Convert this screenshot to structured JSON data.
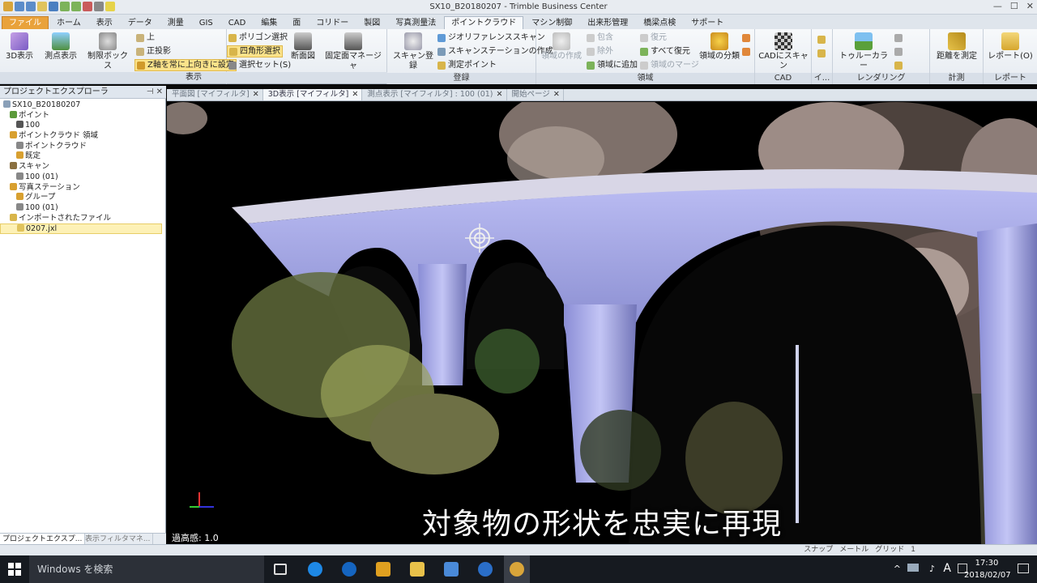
{
  "window": {
    "title": "SX10_B20180207 - Trimble Business Center"
  },
  "tabs": [
    "ファイル",
    "ホーム",
    "表示",
    "データ",
    "測量",
    "GIS",
    "CAD",
    "編集",
    "面",
    "コリドー",
    "製図",
    "写真測量法",
    "ポイントクラウド",
    "マシン制御",
    "出来形管理",
    "橋梁点検",
    "サポート"
  ],
  "ribbon": {
    "view": {
      "label": "表示",
      "buttons": [
        "3D表示",
        "測点表示",
        "制限ボックス",
        "断面図",
        "固定面マネージャ"
      ],
      "small": [
        "上",
        "正投影",
        "Z軸を常に上向きに設定",
        "ポリゴン選択",
        "四角形選択",
        "選択セット(S)"
      ]
    },
    "register": {
      "label": "登録",
      "buttons": [
        "スキャン登録"
      ],
      "small": [
        "ジオリファレンススキャン",
        "スキャンステーションの作成",
        "測定ポイント"
      ]
    },
    "region": {
      "label": "領域",
      "buttons": [
        "領域の作成",
        "領域の分類"
      ],
      "small": [
        "包含",
        "除外",
        "領域に追加",
        "復元",
        "すべて復元",
        "領域のマージ"
      ]
    },
    "cad": {
      "label": "CAD",
      "buttons": [
        "CADにスキャン"
      ]
    },
    "misc": {
      "label": "イ..."
    },
    "render": {
      "label": "レンダリング",
      "buttons": [
        "トゥルーカラー"
      ]
    },
    "measure": {
      "label": "計測",
      "buttons": [
        "距離を測定"
      ]
    },
    "report": {
      "label": "レポート",
      "buttons": [
        "レポート(O)"
      ]
    }
  },
  "explorer": {
    "title": "プロジェクトエクスプローラ",
    "items": [
      {
        "label": "SX10_B20180207",
        "indent": 0
      },
      {
        "label": "ポイント",
        "indent": 1
      },
      {
        "label": "100",
        "indent": 2
      },
      {
        "label": "ポイントクラウド 領域",
        "indent": 1
      },
      {
        "label": "ポイントクラウド",
        "indent": 2
      },
      {
        "label": "既定",
        "indent": 2
      },
      {
        "label": "スキャン",
        "indent": 1
      },
      {
        "label": "100 (01)",
        "indent": 2
      },
      {
        "label": "写真ステーション",
        "indent": 1
      },
      {
        "label": "グループ",
        "indent": 2
      },
      {
        "label": "100 (01)",
        "indent": 2
      },
      {
        "label": "インポートされたファイル",
        "indent": 1
      },
      {
        "label": "0207.jxl",
        "indent": 2,
        "selected": true
      }
    ],
    "bottom_tabs": [
      "プロジェクトエクスプ...",
      "表示フィルタマネ..."
    ]
  },
  "view_tabs": [
    {
      "label": "平面図 [マイフィルタ]",
      "active": false
    },
    {
      "label": "3D表示 [マイフィルタ]",
      "active": true
    },
    {
      "label": "測点表示 [マイフィルタ] : 100 (01)",
      "active": false
    },
    {
      "label": "開始ページ",
      "active": false
    }
  ],
  "viewport": {
    "subtitle": "対象物の形状を忠実に再現",
    "exaggeration": "過高感: 1.0"
  },
  "status": {
    "items": [
      "スナップ",
      "メートル",
      "グリッド",
      "1"
    ]
  },
  "taskbar": {
    "search": "Windows を検索",
    "time": "17:30",
    "date": "2018/02/07",
    "ime": "A"
  }
}
